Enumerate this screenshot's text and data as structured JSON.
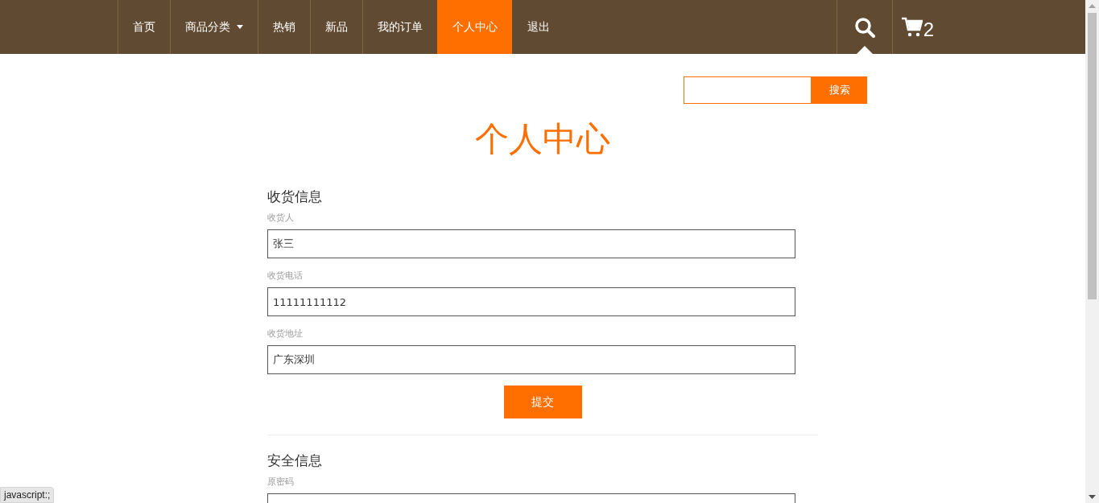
{
  "nav": {
    "items": [
      {
        "label": "首页",
        "selected": false,
        "dropdown": false
      },
      {
        "label": "商品分类",
        "selected": false,
        "dropdown": true
      },
      {
        "label": "热销",
        "selected": false,
        "dropdown": false
      },
      {
        "label": "新品",
        "selected": false,
        "dropdown": false
      },
      {
        "label": "我的订单",
        "selected": false,
        "dropdown": false
      },
      {
        "label": "个人中心",
        "selected": true,
        "dropdown": false
      },
      {
        "label": "退出",
        "selected": false,
        "dropdown": false
      }
    ],
    "cart_count": "2"
  },
  "search": {
    "button": "搜索"
  },
  "title": "个人中心",
  "sections": [
    {
      "heading": "收货信息",
      "fields": [
        {
          "label": "收货人",
          "value": "张三"
        },
        {
          "label": "收货电话",
          "value": "11111111112"
        },
        {
          "label": "收货地址",
          "value": "广东深圳"
        }
      ],
      "submit": "提交"
    },
    {
      "heading": "安全信息",
      "fields": [
        {
          "label": "原密码"
        }
      ]
    }
  ],
  "status_bar": "javascript:;"
}
